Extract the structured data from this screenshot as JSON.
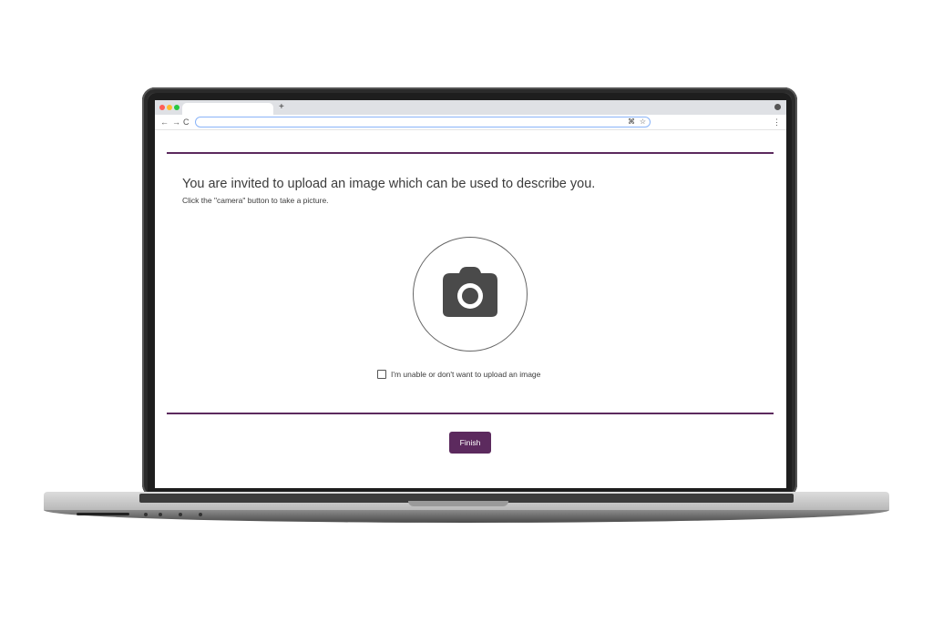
{
  "browser": {
    "new_tab_label": "+",
    "nav": {
      "back": "←",
      "forward": "→",
      "reload": "C"
    },
    "address": {
      "value": "",
      "placeholder": ""
    },
    "omnibox_icons": [
      "⌘",
      "☆"
    ],
    "menu_glyph": "⋮"
  },
  "page": {
    "title": "You are invited to upload an image which can be used to describe you.",
    "subtitle": "Click the \"camera\" button to take a picture.",
    "opt_out_label": "I'm unable or don't want to upload an image",
    "finish_label": "Finish"
  },
  "colors": {
    "accent": "#5c2a5e",
    "text": "#3b3b3b",
    "camera_icon": "#4a4a4a"
  },
  "icons": [
    "camera-icon",
    "checkbox-icon",
    "star-icon",
    "back-icon",
    "forward-icon",
    "reload-icon",
    "menu-icon"
  ]
}
